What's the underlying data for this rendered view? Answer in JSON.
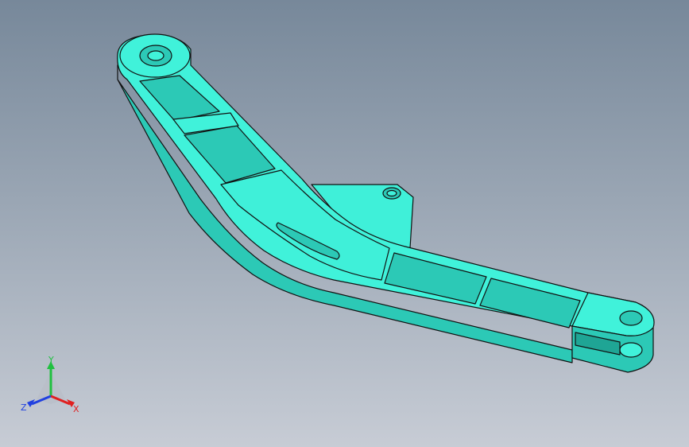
{
  "viewport": {
    "background_top": "#77889a",
    "background_bottom": "#c7ccd5"
  },
  "part": {
    "body_color": "#3ff0d9",
    "top_face_color": "#40f2da",
    "side_face_color": "#2cc9b6",
    "edge_color": "#111111"
  },
  "triad": {
    "x_label": "X",
    "y_label": "Y",
    "z_label": "Z",
    "x_color": "#e02020",
    "y_color": "#20c040",
    "z_color": "#2040e0"
  }
}
